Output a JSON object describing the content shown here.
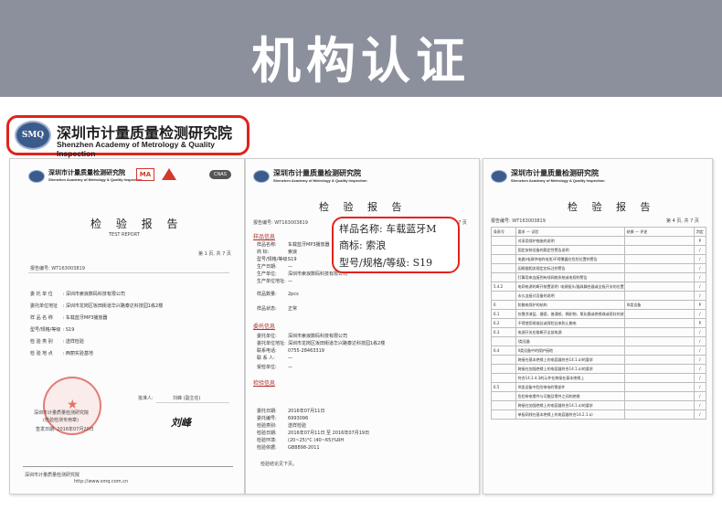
{
  "banner": {
    "title": "机构认证",
    "background": "#8c909c"
  },
  "callout": {
    "logo_text": "SMQ",
    "name_cn": "深圳市计量质量检测研究院",
    "name_en": "Shenzhen Academy of Metrology & Quality Inspection",
    "border_color": "#e1231b"
  },
  "doc1": {
    "org_cn": "深圳市计量质量检测研究院",
    "org_en": "Shenzhen Academy of Metrology & Quality Inspection",
    "marks": {
      "ma": "MA",
      "cnas": "CNAS"
    },
    "title_cn": "检 验 报 告",
    "title_en": "TEST REPORT",
    "page_info": "第 1 页, 共 7 页",
    "report_no": "报告编号: WT163003819",
    "fields": [
      {
        "label": "委 托 单 位",
        "value": "深圳市索浪数码科技有限公司"
      },
      {
        "label": "委托单位地址",
        "value": "深圳市龙岗区坂田街道华兴路泰达科技园1栋2楼"
      },
      {
        "label": "样 品 名 称",
        "value": "车载蓝牙MP3播放器"
      },
      {
        "label": "型号/规格/等级",
        "value": "S19"
      },
      {
        "label": "检 验 类 别",
        "value": "送样检验"
      },
      {
        "label": "检 验 地 点",
        "value": "西丽实验基地"
      }
    ],
    "stamp_caption": "深圳市计量质量检测研究院",
    "stamp_sub": "(检验检测专用章)",
    "sign_date": "签发日期: 2016年07月20日",
    "approver_label": "批准人:",
    "approver_name": "刘峰 (副主任)",
    "signature": "刘峰",
    "footer_org": "深圳市计量质量检测研究院",
    "footer_web": "http://www.smq.com.cn"
  },
  "doc2": {
    "org_cn": "深圳市计量质量检测研究院",
    "org_en": "Shenzhen Academy of Metrology & Quality Inspection",
    "title_cn": "检 验 报 告",
    "report_no": "报告编号: WT163003819",
    "page_info": "第 2 页, 共 7 页",
    "section_sample": "样品信息",
    "sample_fields": [
      {
        "label": "样品名称:",
        "value": "车载蓝牙MP3播放器"
      },
      {
        "label": "商    标:",
        "value": "索浪"
      },
      {
        "label": "型号/规格/等级:",
        "value": "S19"
      },
      {
        "label": "生产日期:",
        "value": "—"
      },
      {
        "label": "生产单位:",
        "value": "深圳市索浪数码科技有限公司"
      },
      {
        "label": "生产单位地址:",
        "value": "—"
      },
      {
        "label": "样品数量:",
        "value": "2pcs"
      },
      {
        "label": "样品状态:",
        "value": "正常"
      }
    ],
    "section_client": "委托信息",
    "client_fields": [
      {
        "label": "委托单位:",
        "value": "深圳市索浪数码科技有限公司"
      },
      {
        "label": "委托单位地址:",
        "value": "深圳市龙岗区坂田街道华兴路泰达科技园1栋2楼"
      },
      {
        "label": "联系电话:",
        "value": "0755-28463319"
      },
      {
        "label": "联 系 人:",
        "value": "—"
      },
      {
        "label": "受检单位:",
        "value": "—"
      }
    ],
    "section_test": "检验信息",
    "test_fields": [
      {
        "label": "委托日期:",
        "value": "2016年07月11日"
      },
      {
        "label": "委托编号:",
        "value": "6993096"
      },
      {
        "label": "检验类别:",
        "value": "送样检验"
      },
      {
        "label": "检验日期:",
        "value": "2016年07月11日 至 2016年07月19日"
      },
      {
        "label": "检验环境:",
        "value": "(20~25)°C  (40~65)%RH"
      },
      {
        "label": "检验依据:",
        "value": "GB8898-2011"
      }
    ],
    "conclusion": "检验结论见下页。",
    "zoom": {
      "line1": "样品名称:  车载蓝牙M",
      "line2": "商标:  索浪",
      "line3": "型号/规格/等级:  S19"
    }
  },
  "doc3": {
    "org_cn": "深圳市计量质量检测研究院",
    "org_en": "Shenzhen Academy of Metrology & Quality Inspection",
    "title_cn": "检 验 报 告",
    "report_no": "报告编号: WT163003819",
    "page_info": "第 4 页, 共 7 页",
    "header": [
      "条款号",
      "要求 — 试验",
      "结果 — 评述",
      "判定"
    ],
    "rows": [
      {
        "no": "",
        "text": "对采用保护措施的说明",
        "result": "",
        "mark": "P"
      },
      {
        "no": "",
        "text": "固定安装设备的稳定性警告说明",
        "result": "",
        "mark": "/"
      },
      {
        "no": "",
        "text": "电路(电源供电的电池)不得暴露在危险位置的警告",
        "result": "",
        "mark": "/"
      },
      {
        "no": "",
        "text": "因根据相关规定应标注的警告",
        "result": "",
        "mark": "/"
      },
      {
        "no": "",
        "text": "打算用来连接到有线网络系统或电视的警告",
        "result": "",
        "mark": "/"
      },
      {
        "no": "5.4.2",
        "text": "电网电源的断开装置说明: 电源插头/器具耦合器或全极开关的位置",
        "result": "",
        "mark": "/"
      },
      {
        "no": "",
        "text": "永久连接式设备的说明",
        "result": "",
        "mark": "/"
      },
      {
        "no": "6",
        "text": "防触电保护的结构",
        "result": "III类设备",
        "mark": "P"
      },
      {
        "no": "6.1",
        "text": "仅靠涂漆层、搪瓷、普通纸、棉织物、氧化膜或绝缘珠或密封剂进行绝缘的结构",
        "result": "",
        "mark": "/"
      },
      {
        "no": "6.2",
        "text": "不得使用易熔丝或保险丝来防止触电",
        "result": "",
        "mark": "P"
      },
      {
        "no": "6.3",
        "text": "电源开关应能断开全部电源",
        "result": "",
        "mark": "/"
      },
      {
        "no": "",
        "text": "I类设备",
        "result": "",
        "mark": "/"
      },
      {
        "no": "6.4",
        "text": "II类设备中的保护接地",
        "result": "",
        "mark": "/"
      },
      {
        "no": "",
        "text": "跨接在基本绝缘上的电容器符合14.1.a)的要求",
        "result": "",
        "mark": "/"
      },
      {
        "no": "",
        "text": "跨接在加强绝缘上的电容器符合14.1.a)的要求",
        "result": "",
        "mark": "/"
      },
      {
        "no": "",
        "text": "符合14.3.4.3的元件在跨接在基本绝缘上",
        "result": "",
        "mark": "/"
      },
      {
        "no": "6.5",
        "text": "III类设备中危险带电的零部件",
        "result": "",
        "mark": "/"
      },
      {
        "no": "",
        "text": "危险带电零件与可触及零件之间的绝缘",
        "result": "",
        "mark": "/"
      },
      {
        "no": "",
        "text": "跨接在加强绝缘上的电容器符合14.1.a)的要求",
        "result": "",
        "mark": "/"
      },
      {
        "no": "",
        "text": "单极网线在基本绝缘上的电容器符合14.2.1.a)",
        "result": "",
        "mark": "/"
      }
    ]
  }
}
